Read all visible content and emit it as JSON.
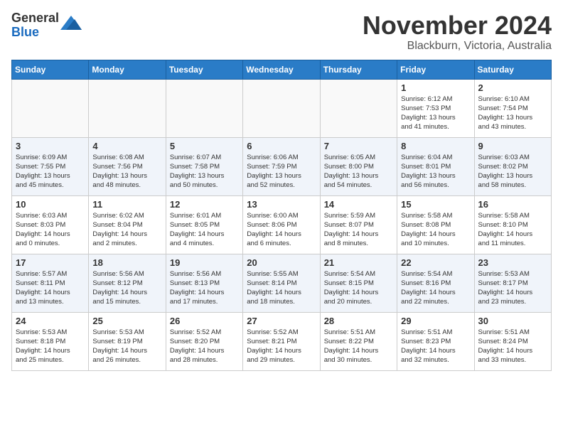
{
  "header": {
    "logo_general": "General",
    "logo_blue": "Blue",
    "month_title": "November 2024",
    "location": "Blackburn, Victoria, Australia"
  },
  "weekdays": [
    "Sunday",
    "Monday",
    "Tuesday",
    "Wednesday",
    "Thursday",
    "Friday",
    "Saturday"
  ],
  "weeks": [
    [
      {
        "day": "",
        "info": ""
      },
      {
        "day": "",
        "info": ""
      },
      {
        "day": "",
        "info": ""
      },
      {
        "day": "",
        "info": ""
      },
      {
        "day": "",
        "info": ""
      },
      {
        "day": "1",
        "info": "Sunrise: 6:12 AM\nSunset: 7:53 PM\nDaylight: 13 hours\nand 41 minutes."
      },
      {
        "day": "2",
        "info": "Sunrise: 6:10 AM\nSunset: 7:54 PM\nDaylight: 13 hours\nand 43 minutes."
      }
    ],
    [
      {
        "day": "3",
        "info": "Sunrise: 6:09 AM\nSunset: 7:55 PM\nDaylight: 13 hours\nand 45 minutes."
      },
      {
        "day": "4",
        "info": "Sunrise: 6:08 AM\nSunset: 7:56 PM\nDaylight: 13 hours\nand 48 minutes."
      },
      {
        "day": "5",
        "info": "Sunrise: 6:07 AM\nSunset: 7:58 PM\nDaylight: 13 hours\nand 50 minutes."
      },
      {
        "day": "6",
        "info": "Sunrise: 6:06 AM\nSunset: 7:59 PM\nDaylight: 13 hours\nand 52 minutes."
      },
      {
        "day": "7",
        "info": "Sunrise: 6:05 AM\nSunset: 8:00 PM\nDaylight: 13 hours\nand 54 minutes."
      },
      {
        "day": "8",
        "info": "Sunrise: 6:04 AM\nSunset: 8:01 PM\nDaylight: 13 hours\nand 56 minutes."
      },
      {
        "day": "9",
        "info": "Sunrise: 6:03 AM\nSunset: 8:02 PM\nDaylight: 13 hours\nand 58 minutes."
      }
    ],
    [
      {
        "day": "10",
        "info": "Sunrise: 6:03 AM\nSunset: 8:03 PM\nDaylight: 14 hours\nand 0 minutes."
      },
      {
        "day": "11",
        "info": "Sunrise: 6:02 AM\nSunset: 8:04 PM\nDaylight: 14 hours\nand 2 minutes."
      },
      {
        "day": "12",
        "info": "Sunrise: 6:01 AM\nSunset: 8:05 PM\nDaylight: 14 hours\nand 4 minutes."
      },
      {
        "day": "13",
        "info": "Sunrise: 6:00 AM\nSunset: 8:06 PM\nDaylight: 14 hours\nand 6 minutes."
      },
      {
        "day": "14",
        "info": "Sunrise: 5:59 AM\nSunset: 8:07 PM\nDaylight: 14 hours\nand 8 minutes."
      },
      {
        "day": "15",
        "info": "Sunrise: 5:58 AM\nSunset: 8:08 PM\nDaylight: 14 hours\nand 10 minutes."
      },
      {
        "day": "16",
        "info": "Sunrise: 5:58 AM\nSunset: 8:10 PM\nDaylight: 14 hours\nand 11 minutes."
      }
    ],
    [
      {
        "day": "17",
        "info": "Sunrise: 5:57 AM\nSunset: 8:11 PM\nDaylight: 14 hours\nand 13 minutes."
      },
      {
        "day": "18",
        "info": "Sunrise: 5:56 AM\nSunset: 8:12 PM\nDaylight: 14 hours\nand 15 minutes."
      },
      {
        "day": "19",
        "info": "Sunrise: 5:56 AM\nSunset: 8:13 PM\nDaylight: 14 hours\nand 17 minutes."
      },
      {
        "day": "20",
        "info": "Sunrise: 5:55 AM\nSunset: 8:14 PM\nDaylight: 14 hours\nand 18 minutes."
      },
      {
        "day": "21",
        "info": "Sunrise: 5:54 AM\nSunset: 8:15 PM\nDaylight: 14 hours\nand 20 minutes."
      },
      {
        "day": "22",
        "info": "Sunrise: 5:54 AM\nSunset: 8:16 PM\nDaylight: 14 hours\nand 22 minutes."
      },
      {
        "day": "23",
        "info": "Sunrise: 5:53 AM\nSunset: 8:17 PM\nDaylight: 14 hours\nand 23 minutes."
      }
    ],
    [
      {
        "day": "24",
        "info": "Sunrise: 5:53 AM\nSunset: 8:18 PM\nDaylight: 14 hours\nand 25 minutes."
      },
      {
        "day": "25",
        "info": "Sunrise: 5:53 AM\nSunset: 8:19 PM\nDaylight: 14 hours\nand 26 minutes."
      },
      {
        "day": "26",
        "info": "Sunrise: 5:52 AM\nSunset: 8:20 PM\nDaylight: 14 hours\nand 28 minutes."
      },
      {
        "day": "27",
        "info": "Sunrise: 5:52 AM\nSunset: 8:21 PM\nDaylight: 14 hours\nand 29 minutes."
      },
      {
        "day": "28",
        "info": "Sunrise: 5:51 AM\nSunset: 8:22 PM\nDaylight: 14 hours\nand 30 minutes."
      },
      {
        "day": "29",
        "info": "Sunrise: 5:51 AM\nSunset: 8:23 PM\nDaylight: 14 hours\nand 32 minutes."
      },
      {
        "day": "30",
        "info": "Sunrise: 5:51 AM\nSunset: 8:24 PM\nDaylight: 14 hours\nand 33 minutes."
      }
    ]
  ]
}
